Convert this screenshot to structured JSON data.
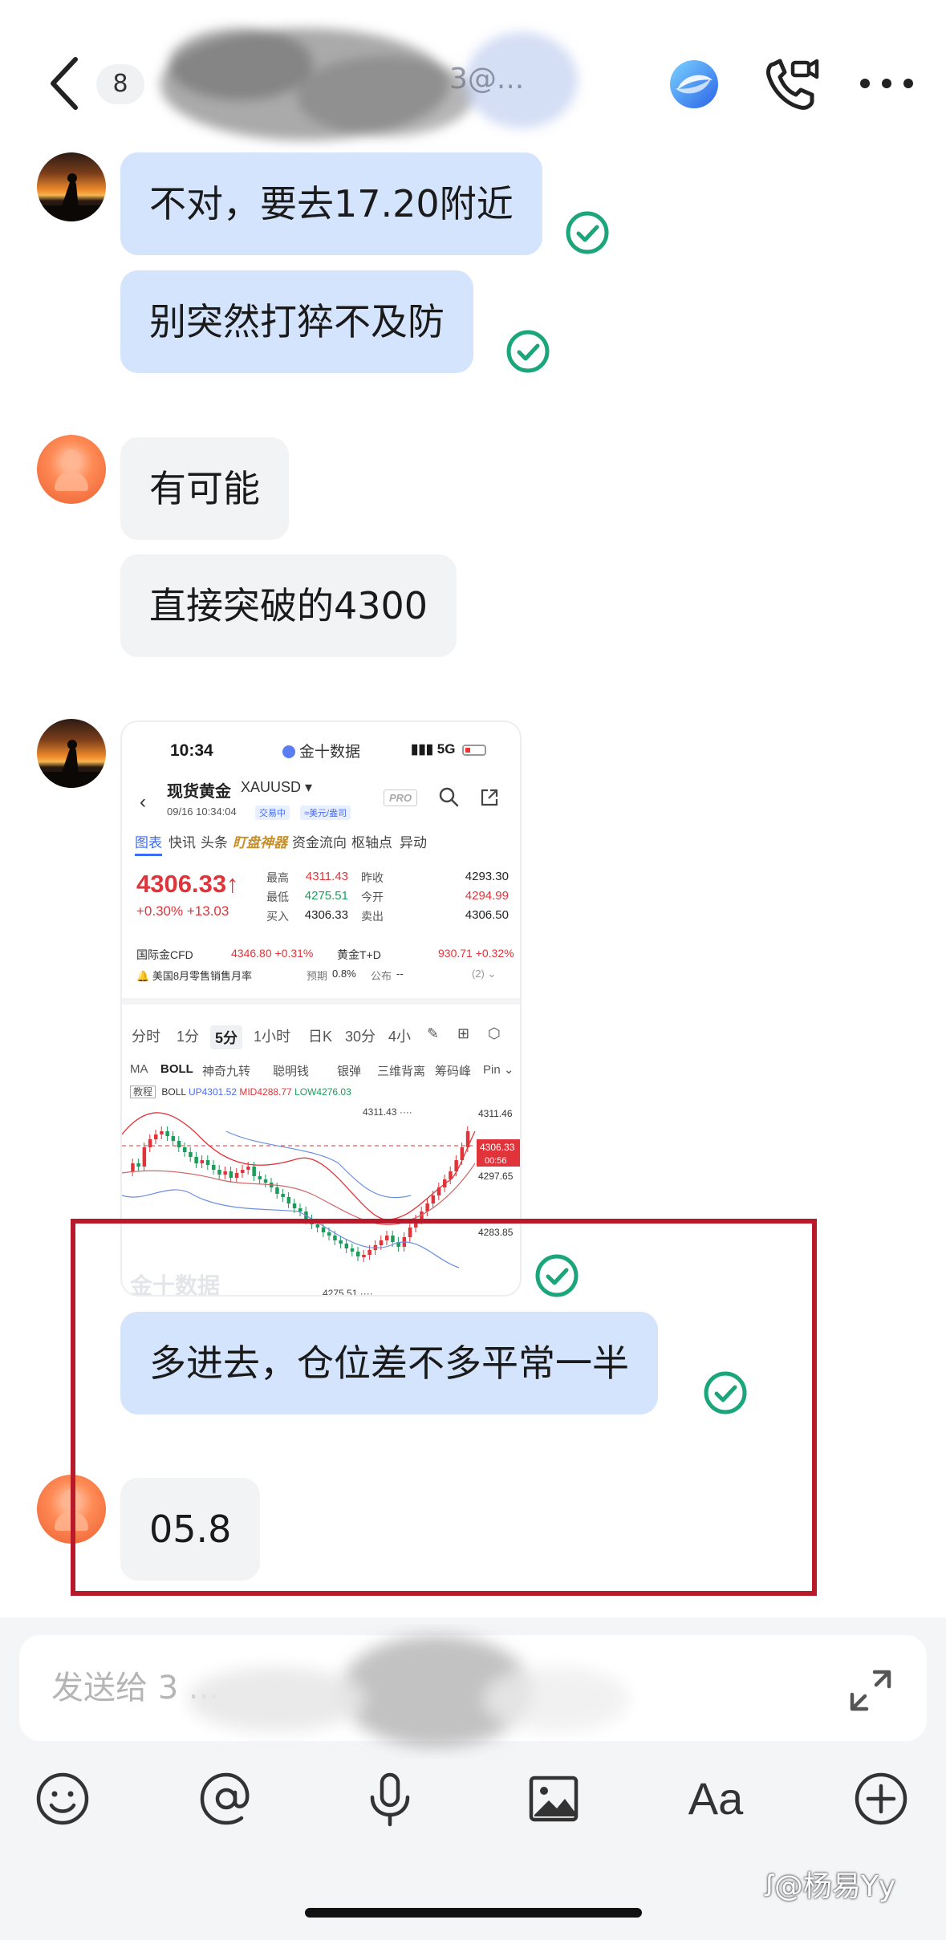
{
  "header": {
    "unread_count": "8",
    "chat_title_partial": "3@...",
    "icons": [
      "back-icon",
      "ai-assistant-icon",
      "video-call-icon",
      "more-icon"
    ]
  },
  "messages": [
    {
      "sender": "me",
      "text": "不对，要去17.20附近",
      "status": "read"
    },
    {
      "sender": "me",
      "text": "别突然打猝不及防",
      "status": "read"
    },
    {
      "sender": "other",
      "text": "有可能"
    },
    {
      "sender": "other",
      "text": "直接突破的4300"
    },
    {
      "sender": "me",
      "type": "image",
      "status": "read"
    },
    {
      "sender": "me",
      "text": "多进去，仓位差不多平常一半",
      "status": "read"
    },
    {
      "sender": "other",
      "text": "05.8"
    }
  ],
  "screenshot": {
    "status_time": "10:34",
    "status_app": "金十数据",
    "status_network": "5G",
    "symbol_name": "现货黄金",
    "symbol_code": "XAUUSD ▾",
    "datetime": "09/16 10:34:04",
    "tag_trading": "交易中",
    "tag_unit": "≈美元/盎司",
    "pro_label": "PRO",
    "tabs": [
      "图表",
      "快讯",
      "头条",
      "盯盘神器",
      "资金流向",
      "枢轴点",
      "异动"
    ],
    "price": "4306.33↑",
    "change": "+0.30%  +13.03",
    "quote_labels": [
      "最高",
      "最低",
      "买入",
      "昨收",
      "今开",
      "卖出"
    ],
    "quote_values": [
      "4311.43",
      "4275.51",
      "4306.33",
      "4293.30",
      "4294.99",
      "4306.50"
    ],
    "cfd_label": "国际金CFD",
    "cfd_value": "4346.80 +0.31%",
    "td_label": "黄金T+D",
    "td_value": "930.71 +0.32%",
    "event_text": "美国8月零售销售月率",
    "event_forecast_label": "预期",
    "event_forecast": "0.8%",
    "event_actual_label": "公布",
    "event_actual": "--",
    "event_count": "(2) ⌄",
    "periods": [
      "分时",
      "1分",
      "5分",
      "1小时",
      "日K",
      "30分",
      "4小"
    ],
    "indicators": [
      "MA",
      "BOLL",
      "神奇九转",
      "聪明钱",
      "银弹",
      "三维背离",
      "筹码峰",
      "Pin ⌄"
    ],
    "boll_label": "教程",
    "boll_name": "BOLL",
    "boll_up": "UP4301.52",
    "boll_mid": "MID4288.77",
    "boll_low": "LOW4276.03",
    "chart_labels": {
      "high_marker": "4311.43 ····",
      "low_marker": "4275.51 ····",
      "axis_top": "4311.46",
      "axis_mid": "4297.65",
      "axis_low": "4283.85",
      "current_price": "4306.33",
      "countdown": "00:56",
      "logo": "金十数据"
    },
    "colors": {
      "up": "#e0343a",
      "down": "#1b9c5a",
      "accent": "#3b6cf6"
    }
  },
  "input": {
    "placeholder": "发送给 3 ...",
    "tools": [
      "emoji-icon",
      "mention-icon",
      "voice-icon",
      "image-icon",
      "text-format-icon",
      "add-icon"
    ],
    "text_format_label": "Aa"
  },
  "watermark": "@杨易Yy",
  "colors": {
    "my_bubble": "#d5e4fd",
    "their_bubble": "#f2f3f5",
    "read_check": "#1aa57a",
    "highlight": "#b8192b"
  }
}
